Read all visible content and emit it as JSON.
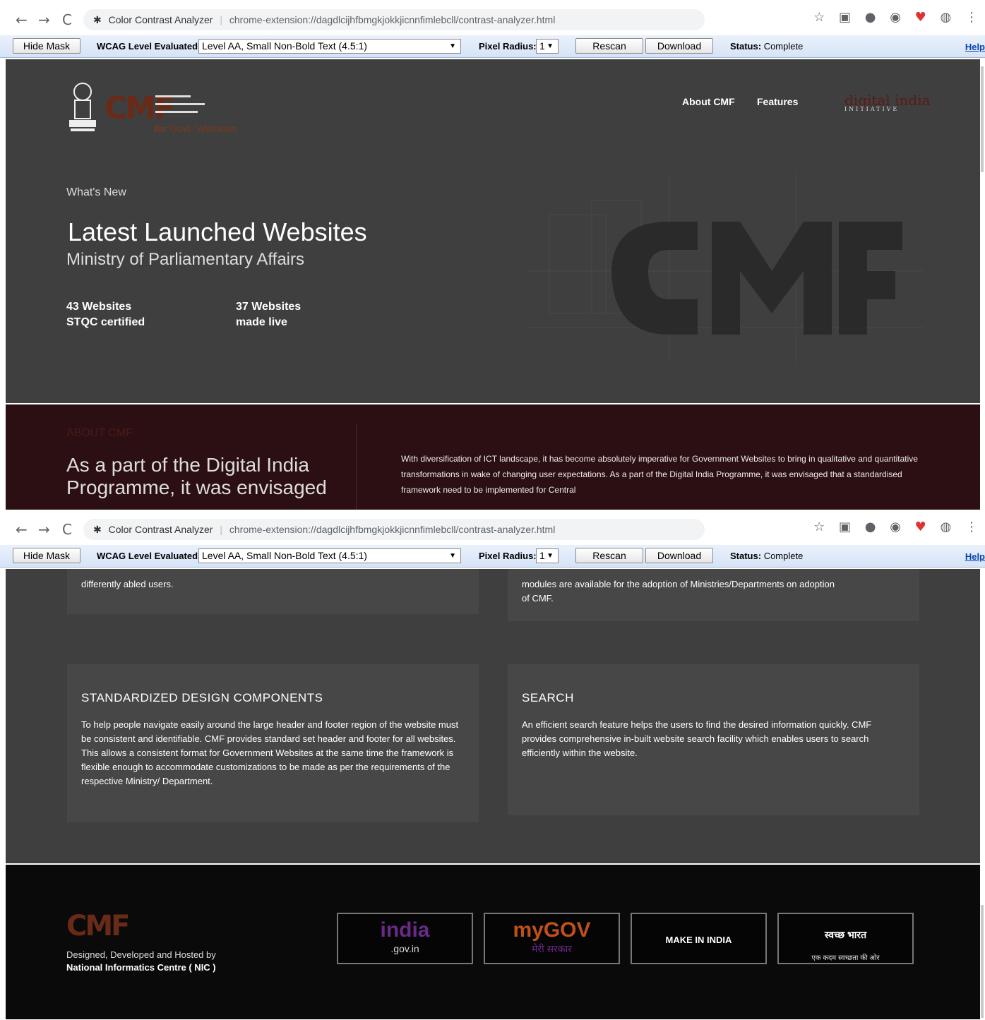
{
  "browser": {
    "extension_name": "Color Contrast Analyzer",
    "url": "chrome-extension://dagdlcijhfbmgkjokkjicnnfimlebcll/contrast-analyzer.html"
  },
  "toolbar": {
    "hide_mask_label": "Hide Mask",
    "wcag_label": "WCAG Level Evaluated:",
    "wcag_value": "Level AA, Small Non-Bold Text (4.5:1)",
    "pixel_radius_label": "Pixel Radius:",
    "pixel_radius_value": "1",
    "rescan_label": "Rescan",
    "download_label": "Download",
    "status_label": "Status:",
    "status_value": "Complete",
    "help_label": "Help"
  },
  "header": {
    "logo_for": "for",
    "logo_tagline": "Govt. Websites",
    "nav": [
      "About CMF",
      "Features"
    ],
    "digital_india": "digital india",
    "digital_india_sub": "INITIATIVE"
  },
  "hero": {
    "whats_new": "What's New",
    "title": "Latest Launched Websites",
    "subtitle": "Ministry of Parliamentary Affairs",
    "stat1_line1": "43 Websites",
    "stat1_line2": "STQC certified",
    "stat2_line1": "37 Websites",
    "stat2_line2": "made live"
  },
  "about": {
    "label": "ABOUT CMF",
    "heading": "As a part of the Digital India Programme, it was envisaged",
    "paragraph": "With diversification of ICT landscape, it has become absolutely imperative for Government Websites to bring in qualitative and quantitative transformations in wake of changing user expectations. As a part of the Digital India Programme, it was envisaged that a standardised framework need to be implemented for Central"
  },
  "features": {
    "card1_fragment": "differently abled users.",
    "card2_fragment_line1": "modules are available for the adoption of Ministries/Departments on adoption",
    "card2_fragment_line2": "of CMF.",
    "card3_title": "STANDARDIZED DESIGN COMPONENTS",
    "card3_text": "To help people navigate easily around the large header and footer region of the website must be consistent and identifiable. CMF provides standard set header and footer for all websites. This allows a consistent format for Government Websites at the same time the framework is flexible enough to accommodate customizations to be made as per the requirements of the respective Ministry/ Department.",
    "card4_title": "SEARCH",
    "card4_text": "An efficient search feature helps the users to find the desired information quickly. CMF provides comprehensive in-built website search facility which enables users to search efficiently within the website."
  },
  "footer": {
    "designed_by": "Designed, Developed and Hosted by",
    "nic": "National Informatics Centre ( NIC )",
    "logos": [
      {
        "line1": "india",
        "line2": ".gov.in"
      },
      {
        "line1": "myGOV",
        "line2": "मेरी सरकार"
      },
      {
        "line1": "MAKE IN INDIA",
        "line2": ""
      },
      {
        "line1": "स्वच्छ भारत",
        "line2": "एक कदम स्वच्छता की ओर"
      }
    ]
  }
}
